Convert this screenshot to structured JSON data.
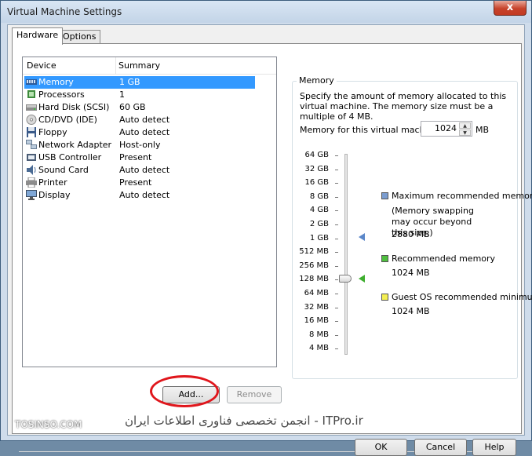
{
  "window": {
    "title": "Virtual Machine Settings",
    "close_label": "x"
  },
  "tabs": [
    {
      "label": "Hardware",
      "active": true
    },
    {
      "label": "Options",
      "active": false
    }
  ],
  "device_list": {
    "headers": [
      "Device",
      "Summary"
    ],
    "rows": [
      {
        "icon": "memory-icon",
        "device": "Memory",
        "summary": "1 GB",
        "selected": true
      },
      {
        "icon": "processor-icon",
        "device": "Processors",
        "summary": "1"
      },
      {
        "icon": "hard-disk-icon",
        "device": "Hard Disk (SCSI)",
        "summary": "60 GB"
      },
      {
        "icon": "cd-dvd-icon",
        "device": "CD/DVD (IDE)",
        "summary": "Auto detect"
      },
      {
        "icon": "floppy-icon",
        "device": "Floppy",
        "summary": "Auto detect"
      },
      {
        "icon": "network-adapter-icon",
        "device": "Network Adapter",
        "summary": "Host-only"
      },
      {
        "icon": "usb-controller-icon",
        "device": "USB Controller",
        "summary": "Present"
      },
      {
        "icon": "sound-card-icon",
        "device": "Sound Card",
        "summary": "Auto detect"
      },
      {
        "icon": "printer-icon",
        "device": "Printer",
        "summary": "Present"
      },
      {
        "icon": "display-icon",
        "device": "Display",
        "summary": "Auto detect"
      }
    ]
  },
  "buttons": {
    "add": "Add...",
    "remove": "Remove",
    "ok": "OK",
    "cancel": "Cancel",
    "help": "Help"
  },
  "memory": {
    "group_title": "Memory",
    "description": "Specify the amount of memory allocated to this virtual machine. The memory size must be a multiple of 4 MB.",
    "field_label": "Memory for this virtual machine:",
    "value": "1024",
    "unit": "MB",
    "scale_labels": [
      "64 GB",
      "32 GB",
      "16 GB",
      "8 GB",
      "4 GB",
      "2 GB",
      "1 GB",
      "512 MB",
      "256 MB",
      "128 MB",
      "64 MB",
      "32 MB",
      "16 MB",
      "8 MB",
      "4 MB"
    ],
    "slider_value": "1 GB",
    "legend": [
      {
        "color": "#7b9dd0",
        "title": "Maximum recommended memory",
        "note": "(Memory swapping may occur beyond this size.)",
        "value": "2880 MB"
      },
      {
        "color": "#4fbf3f",
        "title": "Recommended memory",
        "value": "1024 MB"
      },
      {
        "color": "#f4ef53",
        "title": "Guest OS recommended minimum",
        "value": "1024 MB"
      }
    ]
  },
  "watermark": {
    "site": "TOSINSO.COM",
    "persian": "ITPro.ir - انجمن تخصصی فناوری اطلاعات ایران"
  }
}
